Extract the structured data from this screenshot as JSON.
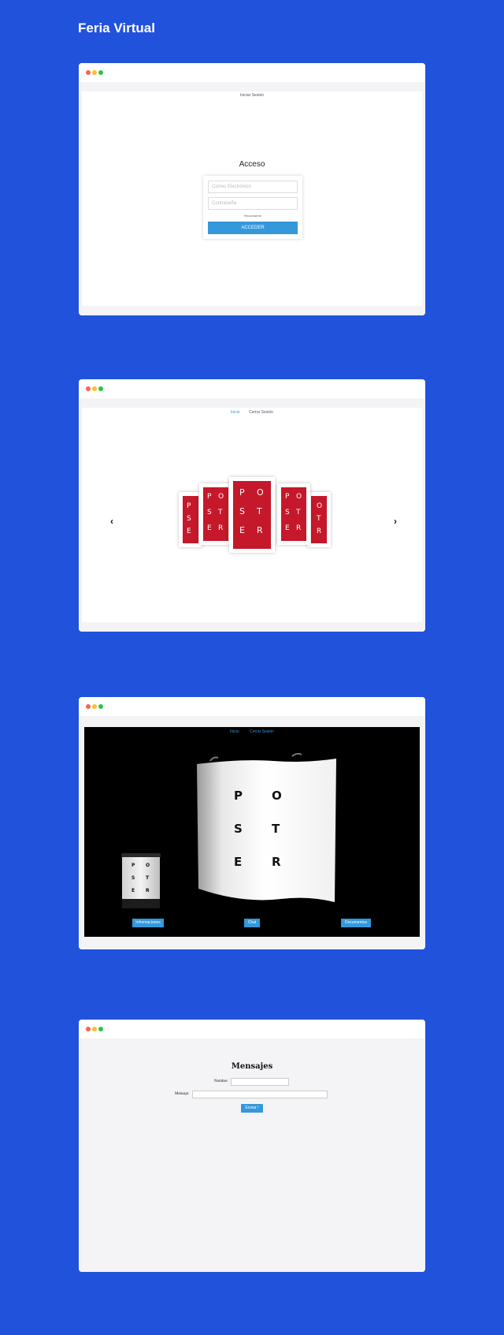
{
  "page_title": "Feria Virtual",
  "login": {
    "nav_link": "Iniciar Sesión",
    "title": "Acceso",
    "email_placeholder": "Correo Electrónico",
    "password_placeholder": "Contraseña",
    "remember": "Recordarme",
    "submit": "ACCEDER"
  },
  "carousel": {
    "nav": [
      "Inicio",
      "Cerrar Sesión"
    ],
    "prev_arrow": "‹",
    "next_arrow": "›",
    "poster_letters": [
      "P",
      "O",
      "S",
      "T",
      "E",
      "R"
    ],
    "poster_color": "#c5182a"
  },
  "stand": {
    "nav": [
      "Inicio",
      "Cerrar Sesión"
    ],
    "poster_letters": [
      "P",
      "O",
      "S",
      "T",
      "E",
      "R"
    ],
    "buttons": [
      "Informaciones",
      "Chat",
      "Documentos"
    ]
  },
  "messages": {
    "title": "Mensajes",
    "name_label": "Nombre:",
    "message_label": "Mensaje:",
    "submit": "Enviar !"
  },
  "colors": {
    "background": "#2152dc",
    "accent": "#3498db"
  }
}
